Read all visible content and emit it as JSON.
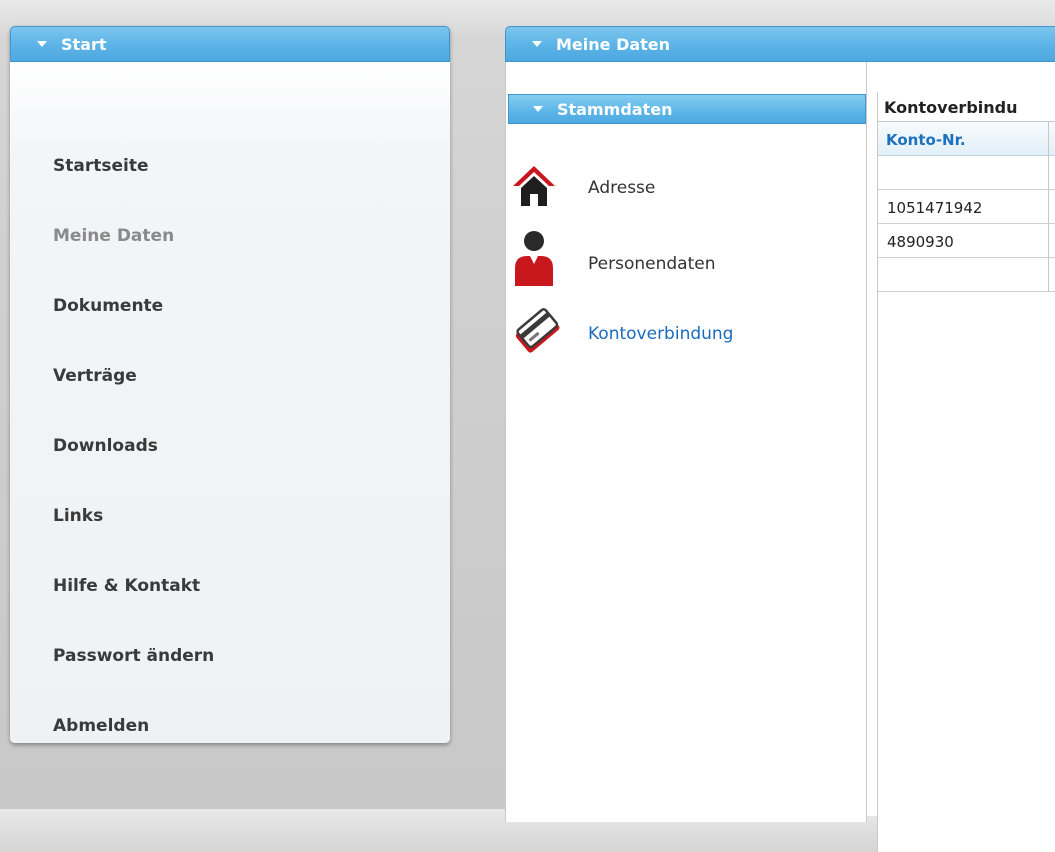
{
  "left_panel": {
    "title": "Start",
    "items": [
      {
        "label": "Startseite",
        "active": false
      },
      {
        "label": "Meine Daten",
        "active": true
      },
      {
        "label": "Dokumente",
        "active": false
      },
      {
        "label": "Verträge",
        "active": false
      },
      {
        "label": "Downloads",
        "active": false
      },
      {
        "label": "Links",
        "active": false
      },
      {
        "label": "Hilfe & Kontakt",
        "active": false
      },
      {
        "label": "Passwort ändern",
        "active": false
      },
      {
        "label": "Abmelden",
        "active": false
      }
    ]
  },
  "right_panel": {
    "title": "Meine Daten",
    "section": {
      "title": "Stammdaten",
      "entries": [
        {
          "label": "Adresse",
          "icon": "house-icon"
        },
        {
          "label": "Personendaten",
          "icon": "person-icon"
        },
        {
          "label": "Kontoverbindung",
          "icon": "bank-card-icon",
          "selected": true
        }
      ]
    },
    "table": {
      "title": "Kontoverbindu",
      "column_header": "Konto-Nr.",
      "rows": [
        "",
        "1051471942",
        "4890930",
        ""
      ]
    }
  },
  "colors": {
    "header_blue": "#5bb3e6",
    "link_blue": "#1a6bbf",
    "icon_red": "#c8181e"
  }
}
